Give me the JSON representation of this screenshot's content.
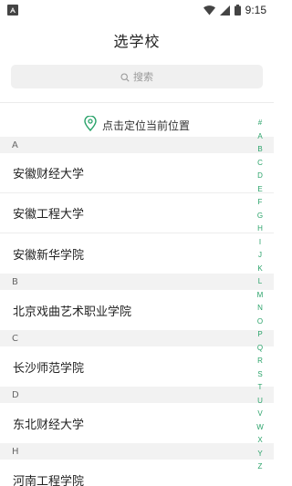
{
  "status_bar": {
    "time": "9:15",
    "app_icon": "notification-a-icon",
    "wifi_icon": "wifi-icon",
    "signal_icon": "cell-signal-icon",
    "battery_icon": "battery-icon"
  },
  "header": {
    "title": "选学校"
  },
  "search": {
    "placeholder": "搜索",
    "icon": "search-icon"
  },
  "location": {
    "label": "点击定位当前位置",
    "icon": "location-pin-icon",
    "accent_color": "#2aa36a"
  },
  "sections": [
    {
      "letter": "A",
      "schools": [
        "安徽财经大学",
        "安徽工程大学",
        "安徽新华学院"
      ]
    },
    {
      "letter": "B",
      "schools": [
        "北京戏曲艺术职业学院"
      ]
    },
    {
      "letter": "C",
      "schools": [
        "长沙师范学院"
      ]
    },
    {
      "letter": "D",
      "schools": [
        "东北财经大学"
      ]
    },
    {
      "letter": "H",
      "schools": [
        "河南工程学院"
      ]
    }
  ],
  "index_letters": [
    "#",
    "A",
    "B",
    "C",
    "D",
    "E",
    "F",
    "G",
    "H",
    "I",
    "J",
    "K",
    "L",
    "M",
    "N",
    "O",
    "P",
    "Q",
    "R",
    "S",
    "T",
    "U",
    "V",
    "W",
    "X",
    "Y",
    "Z"
  ]
}
